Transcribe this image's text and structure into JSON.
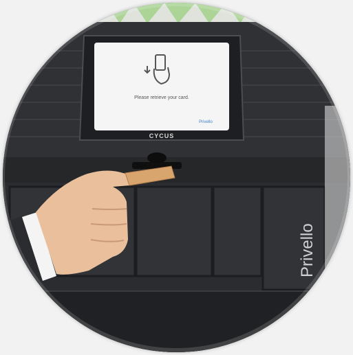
{
  "scene": {
    "screen": {
      "prompt_text": "Please retrieve your card.",
      "screen_logo_text": "Privello"
    },
    "bezel_brand": "CYCUS",
    "side_brand": "Privello"
  },
  "colors": {
    "background": "#f2f2f2",
    "cabinet": "#2c2e31",
    "cabinet_dark": "#1d1f22",
    "screen": "#f5f5f5",
    "skin": "#e9bf9c",
    "sleeve": "#f4f4f4",
    "suit": "#2a2c30",
    "card": "#d9a56e"
  }
}
